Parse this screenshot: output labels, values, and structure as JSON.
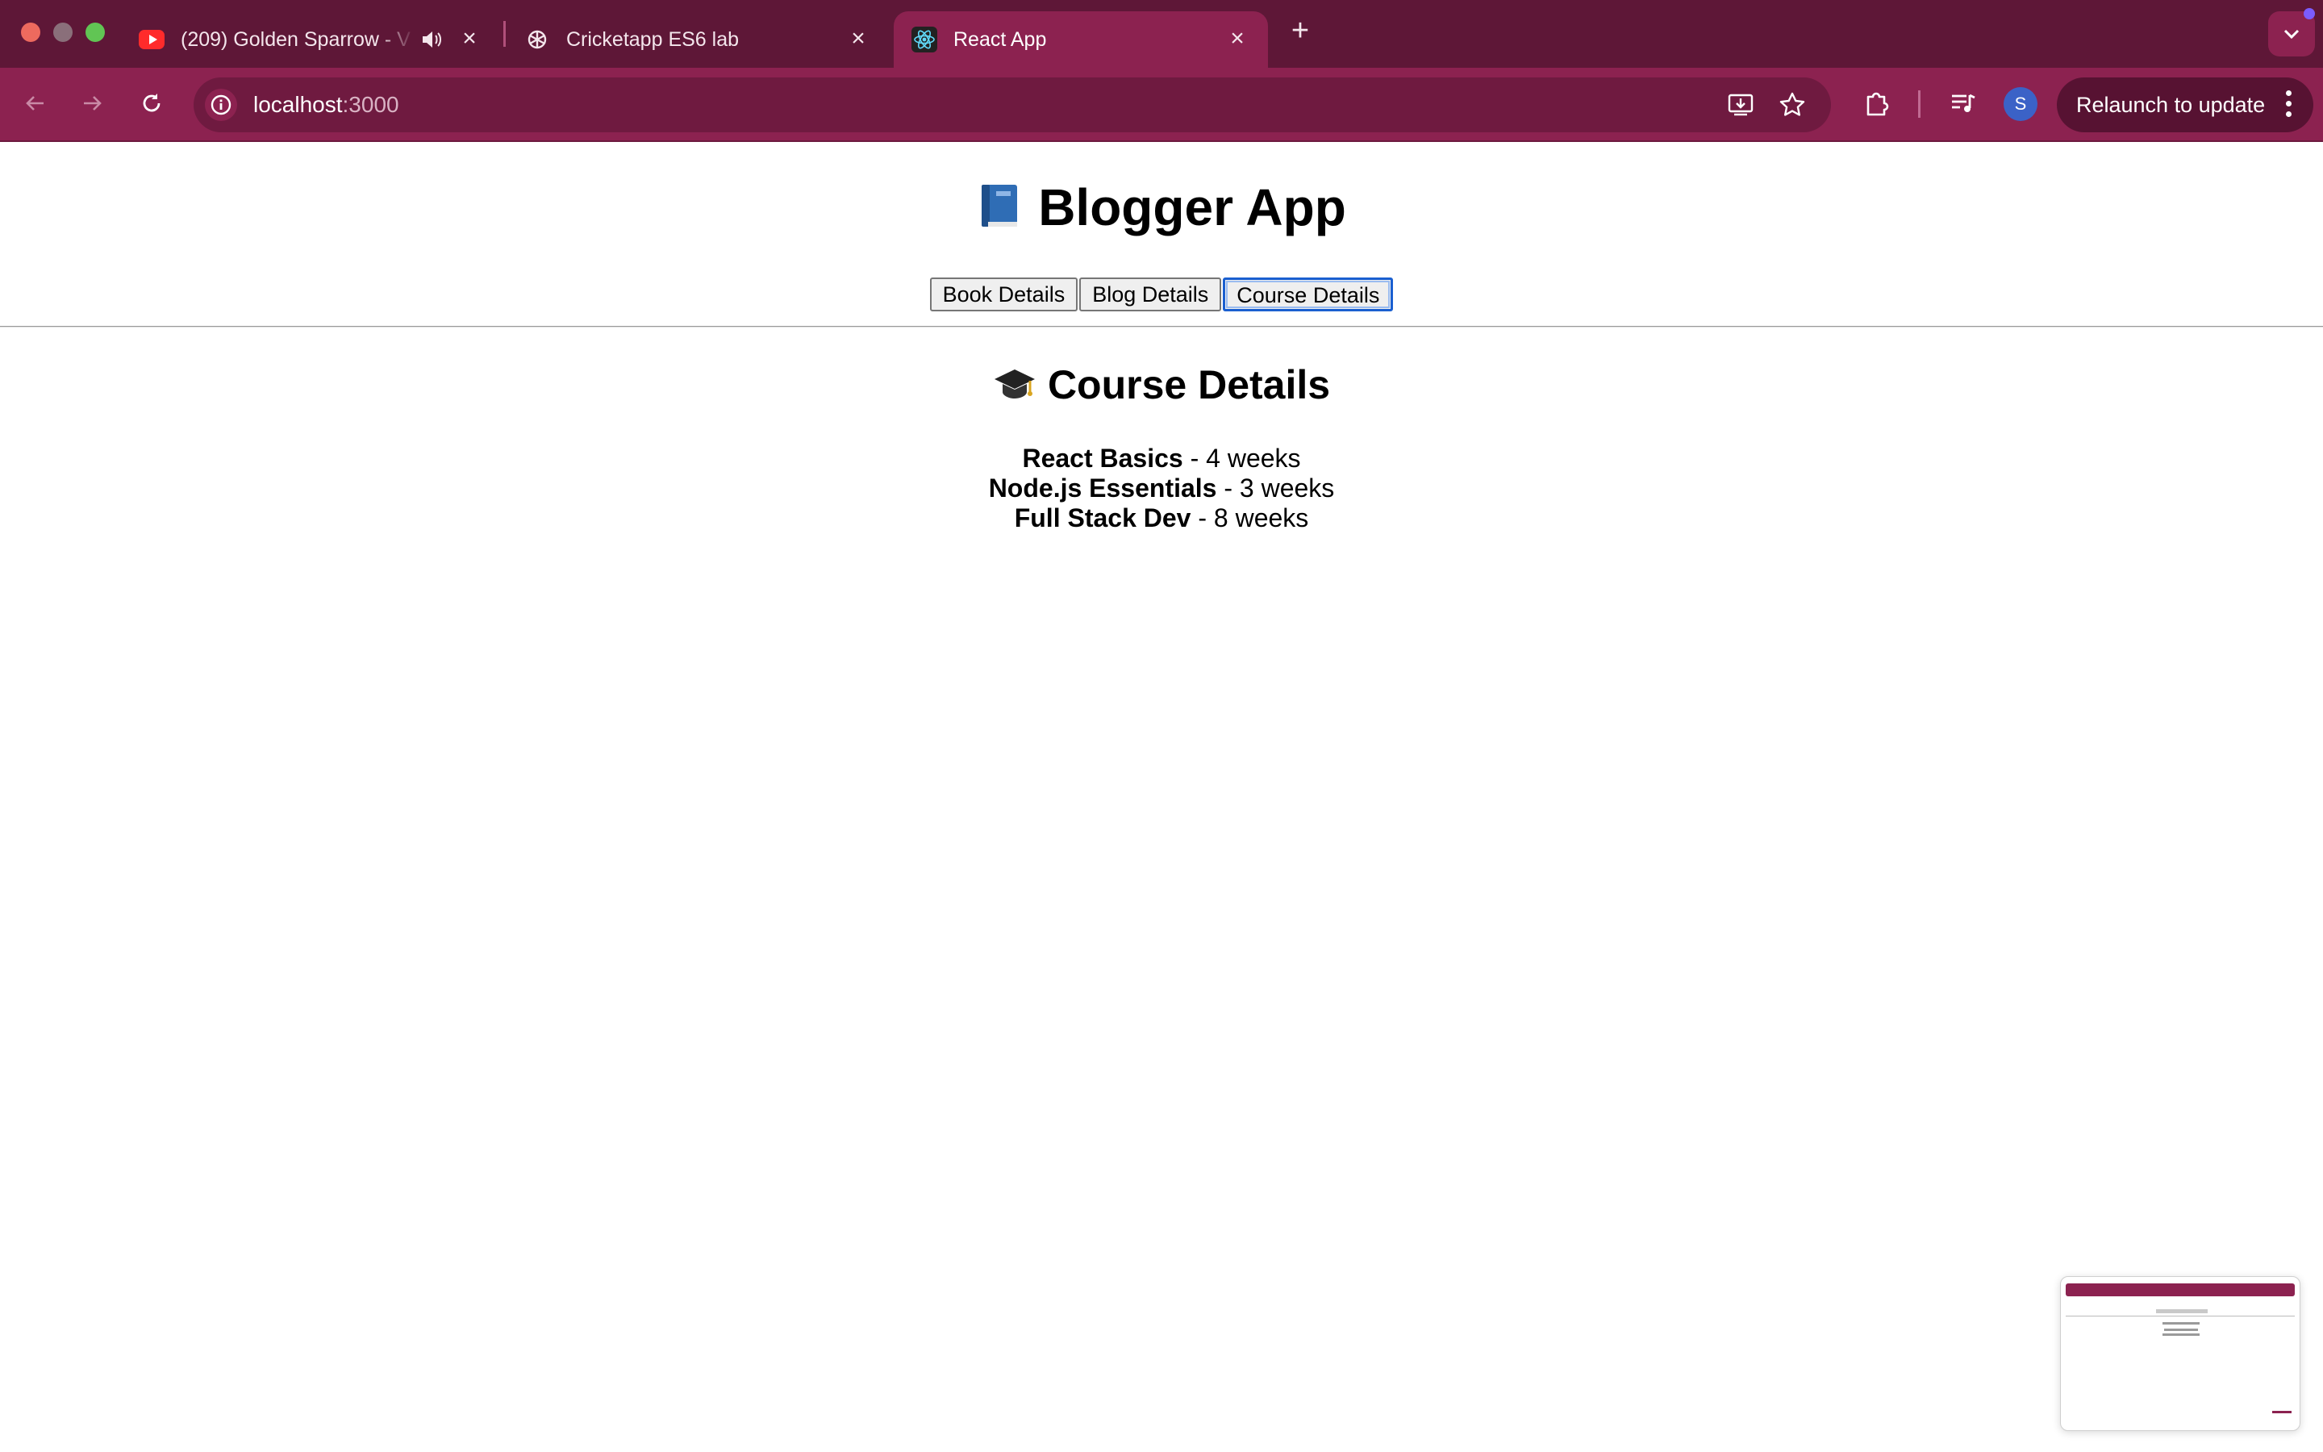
{
  "browser": {
    "tabs": [
      {
        "title": "(209) Golden Sparrow - V",
        "favicon": "youtube-icon",
        "audio": true
      },
      {
        "title": "Cricketapp ES6 lab",
        "favicon": "openai-icon"
      },
      {
        "title": "React App",
        "favicon": "react-icon",
        "active": true
      }
    ],
    "url_host": "localhost",
    "url_port": ":3000",
    "profile_initial": "S",
    "relaunch_label": "Relaunch to update",
    "colors": {
      "frame": "#5e1737",
      "toolbar": "#8c2250",
      "omnibox": "#6f1a40"
    }
  },
  "app": {
    "title": "Blogger App",
    "title_icon": "blue-book-icon",
    "nav_buttons": [
      "Book Details",
      "Blog Details",
      "Course Details"
    ],
    "active_button": "Course Details"
  },
  "section": {
    "title": "Course Details",
    "icon": "graduation-cap-icon",
    "courses": [
      {
        "name": "React Basics",
        "duration": "- 4 weeks"
      },
      {
        "name": "Node.js Essentials",
        "duration": "- 3 weeks"
      },
      {
        "name": "Full Stack Dev",
        "duration": "- 8 weeks"
      }
    ]
  }
}
